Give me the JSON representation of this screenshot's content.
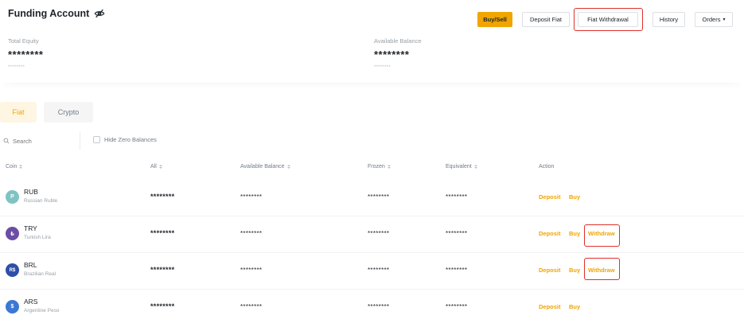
{
  "header": {
    "title": "Funding Account",
    "visibility_icon": "eye-slash-icon",
    "buttons": {
      "buy_sell": "Buy/Sell",
      "deposit_fiat": "Deposit Fiat",
      "fiat_withdrawal": "Fiat Withdrawal",
      "history": "History",
      "orders": "Orders"
    },
    "total_equity": {
      "label": "Total Equity",
      "value": "********",
      "sub": "********"
    },
    "available_balance": {
      "label": "Available Balance",
      "value": "********",
      "sub": "********"
    }
  },
  "tabs": [
    {
      "label": "Fiat",
      "active": true
    },
    {
      "label": "Crypto",
      "active": false
    }
  ],
  "filters": {
    "search_placeholder": "Search",
    "hide_zero_label": "Hide Zero Balances"
  },
  "table": {
    "columns": [
      "Coin",
      "All",
      "Available Balance",
      "Frozen",
      "Equivalent",
      "Action"
    ],
    "rows": [
      {
        "icon_text": "P",
        "icon_color": "#7fc3c2",
        "code": "RUB",
        "name": "Russian Ruble",
        "all": "********",
        "available": "********",
        "frozen": "********",
        "equivalent": "********",
        "actions": [
          "Deposit",
          "Buy"
        ]
      },
      {
        "icon_text": "₺",
        "icon_color": "#6b4ea3",
        "code": "TRY",
        "name": "Turkish Lira",
        "all": "********",
        "available": "********",
        "frozen": "********",
        "equivalent": "********",
        "actions": [
          "Deposit",
          "Buy",
          "Withdraw"
        ]
      },
      {
        "icon_text": "R$",
        "icon_color": "#2e4fa8",
        "code": "BRL",
        "name": "Brazilian Real",
        "all": "********",
        "available": "********",
        "frozen": "********",
        "equivalent": "********",
        "actions": [
          "Deposit",
          "Buy",
          "Withdraw"
        ]
      },
      {
        "icon_text": "$",
        "icon_color": "#3b78d6",
        "code": "ARS",
        "name": "Argentine Peso",
        "all": "********",
        "available": "********",
        "frozen": "********",
        "equivalent": "********",
        "actions": [
          "Deposit",
          "Buy"
        ]
      }
    ]
  },
  "colors": {
    "accent": "#f0a500",
    "highlight": "#e0302a"
  }
}
